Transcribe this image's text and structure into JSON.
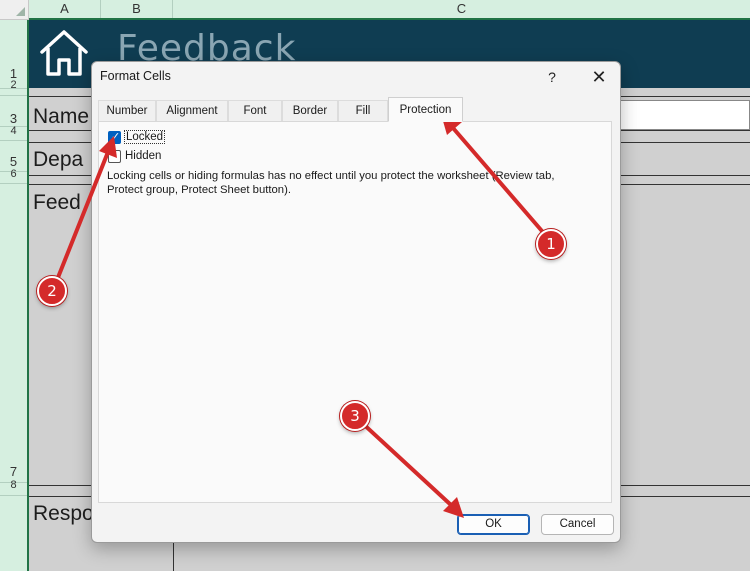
{
  "spreadsheet": {
    "columns": [
      "A",
      "B",
      "C"
    ],
    "rows": [
      "1",
      "2",
      "3",
      "4",
      "5",
      "6",
      "7",
      "8"
    ],
    "banner_title": "Feedback",
    "labels": {
      "name": "Name",
      "department": "Depa",
      "feedback": "Feed",
      "response": "Respo"
    },
    "banner_color": "#0f3d52",
    "header_color": "#d6efe0",
    "accent_color": "#217346",
    "icons": {
      "home": "home-icon"
    }
  },
  "dialog": {
    "title": "Format Cells",
    "help_label": "?",
    "close_label": "✕",
    "tabs": [
      "Number",
      "Alignment",
      "Font",
      "Border",
      "Fill",
      "Protection"
    ],
    "active_tab": "Protection",
    "locked_label": "Locked",
    "locked_checked": true,
    "hidden_label": "Hidden",
    "hidden_checked": false,
    "check_glyph": "✓",
    "description": "Locking cells or hiding formulas has no effect until you protect the worksheet (Review tab, Protect group, Protect Sheet button).",
    "ok_label": "OK",
    "cancel_label": "Cancel",
    "checkbox_color": "#0060c0"
  },
  "annotations": {
    "badges": [
      "1",
      "2",
      "3"
    ],
    "arrow_color": "#d42a2a"
  }
}
